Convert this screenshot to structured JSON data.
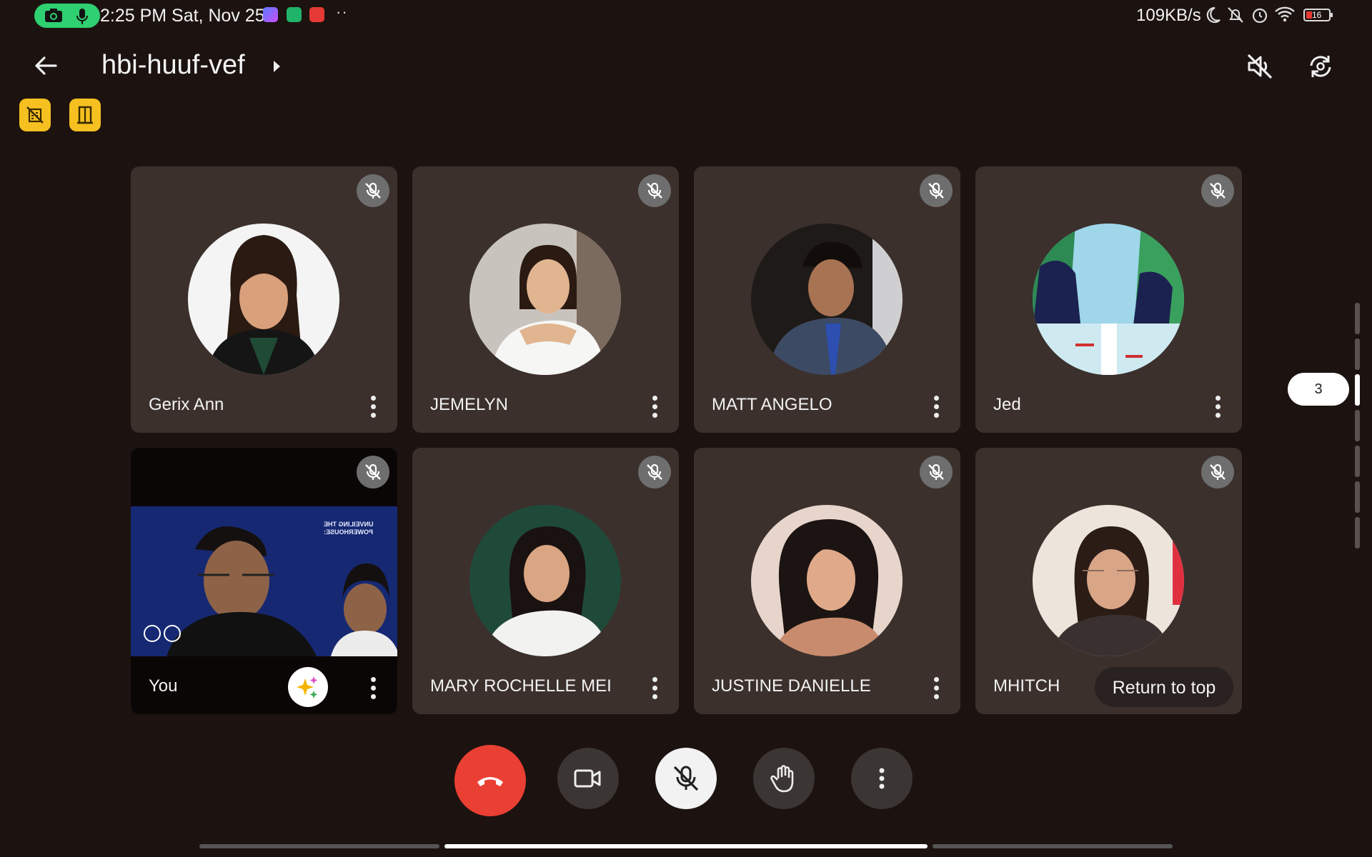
{
  "status_bar": {
    "time": "2:25 PM Sat, Nov 25",
    "overflow_dots": "··",
    "net_speed": "109KB/s",
    "battery": "16",
    "pill_color": "#2fd071"
  },
  "header": {
    "meeting_code": "hbi-huuf-vef"
  },
  "participants": [
    {
      "name": "Gerix Ann",
      "muted": true
    },
    {
      "name": "JEMELYN",
      "muted": true
    },
    {
      "name": "MATT ANGELO",
      "muted": true
    },
    {
      "name": "Jed",
      "muted": true
    },
    {
      "name": "You",
      "muted": true
    },
    {
      "name": "MARY ROCHELLE MEI",
      "muted": true
    },
    {
      "name": "JUSTINE DANIELLE",
      "muted": true
    },
    {
      "name": "MHITCH",
      "muted": true
    }
  ],
  "video_overlay": {
    "line1": "UNVEILING THE",
    "line2": "POWERHOUSE:"
  },
  "return_to_top": "Return to top",
  "page_indicator": "3",
  "controls": {
    "end_call_color": "#ea3f33"
  },
  "icons": [
    "camera-icon",
    "mic-icon",
    "messenger-icon",
    "shield-icon",
    "youtube-icon",
    "moon-icon",
    "bell-off-icon",
    "alarm-icon",
    "wifi-icon",
    "battery-icon",
    "back-arrow-icon",
    "caret-right-icon",
    "speaker-off-icon",
    "switch-camera-icon",
    "no-building-icon",
    "door-icon",
    "mic-off-icon",
    "more-vert-icon",
    "sparkle-icon",
    "phone-hangup-icon",
    "video-camera-icon",
    "raise-hand-icon"
  ]
}
